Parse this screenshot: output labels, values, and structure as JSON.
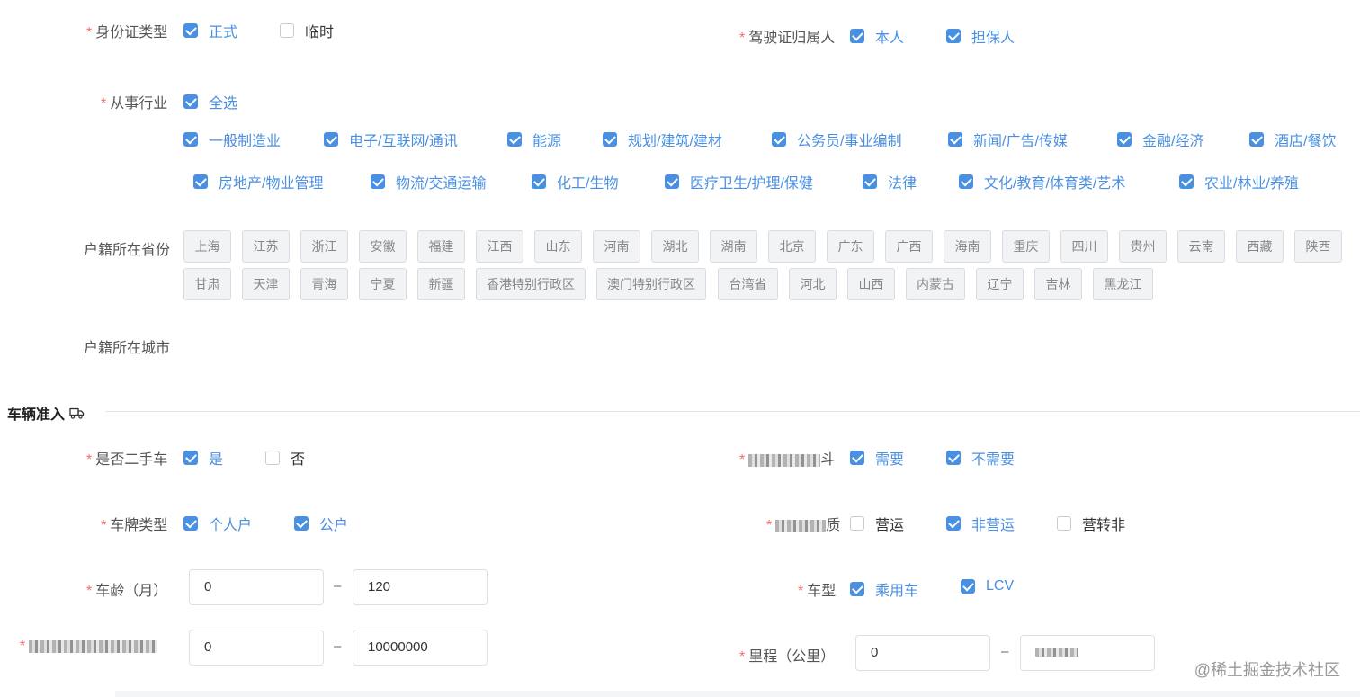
{
  "id_type": {
    "label": "身份证类型",
    "options": [
      {
        "text": "正式",
        "checked": true
      },
      {
        "text": "临时",
        "checked": false
      }
    ]
  },
  "license_owner": {
    "label": "驾驶证归属人",
    "options": [
      {
        "text": "本人",
        "checked": true
      },
      {
        "text": "担保人",
        "checked": true
      }
    ]
  },
  "industry": {
    "label": "从事行业",
    "select_all": "全选",
    "row1": [
      "一般制造业",
      "电子/互联网/通讯",
      "能源",
      "规划/建筑/建材",
      "公务员/事业编制",
      "新闻/广告/传媒",
      "金融/经济",
      "酒店/餐饮"
    ],
    "row2": [
      "房地产/物业管理",
      "物流/交通运输",
      "化工/生物",
      "医疗卫生/护理/保健",
      "法律",
      "文化/教育/体育类/艺术",
      "农业/林业/养殖"
    ]
  },
  "province": {
    "label": "户籍所在省份",
    "row1": [
      "上海",
      "江苏",
      "浙江",
      "安徽",
      "福建",
      "江西",
      "山东",
      "河南",
      "湖北",
      "湖南",
      "北京",
      "广东",
      "广西",
      "海南",
      "重庆",
      "四川",
      "贵州",
      "云南",
      "西藏",
      "陕西"
    ],
    "row2": [
      "甘肃",
      "天津",
      "青海",
      "宁夏",
      "新疆",
      "香港特别行政区",
      "澳门特别行政区",
      "台湾省",
      "河北",
      "山西",
      "内蒙古",
      "辽宁",
      "吉林",
      "黑龙江"
    ]
  },
  "city": {
    "label": "户籍所在城市"
  },
  "vehicle_section": {
    "title": "车辆准入"
  },
  "used_car": {
    "label": "是否二手车",
    "options": [
      {
        "text": "是",
        "checked": true
      },
      {
        "text": "否",
        "checked": false
      }
    ]
  },
  "need_field": {
    "label_suffix": "斗",
    "options": [
      {
        "text": "需要",
        "checked": true
      },
      {
        "text": "不需要",
        "checked": true
      }
    ]
  },
  "plate_type": {
    "label": "车牌类型",
    "options": [
      {
        "text": "个人户",
        "checked": true
      },
      {
        "text": "公户",
        "checked": true
      }
    ]
  },
  "nature_field": {
    "label_suffix": "质",
    "options": [
      {
        "text": "营运",
        "checked": false
      },
      {
        "text": "非营运",
        "checked": true
      },
      {
        "text": "营转非",
        "checked": false
      }
    ]
  },
  "car_age": {
    "label": "车龄（月）",
    "min": "0",
    "max": "120",
    "sep": "–"
  },
  "car_model": {
    "label": "车型",
    "options": [
      {
        "text": "乘用车",
        "checked": true
      },
      {
        "text": "LCV",
        "checked": true
      }
    ]
  },
  "price_range": {
    "min": "0",
    "max": "10000000",
    "sep": "–"
  },
  "mileage": {
    "label": "里程（公里）",
    "min": "0",
    "sep": "–"
  },
  "watermark": "@稀土掘金技术社区"
}
